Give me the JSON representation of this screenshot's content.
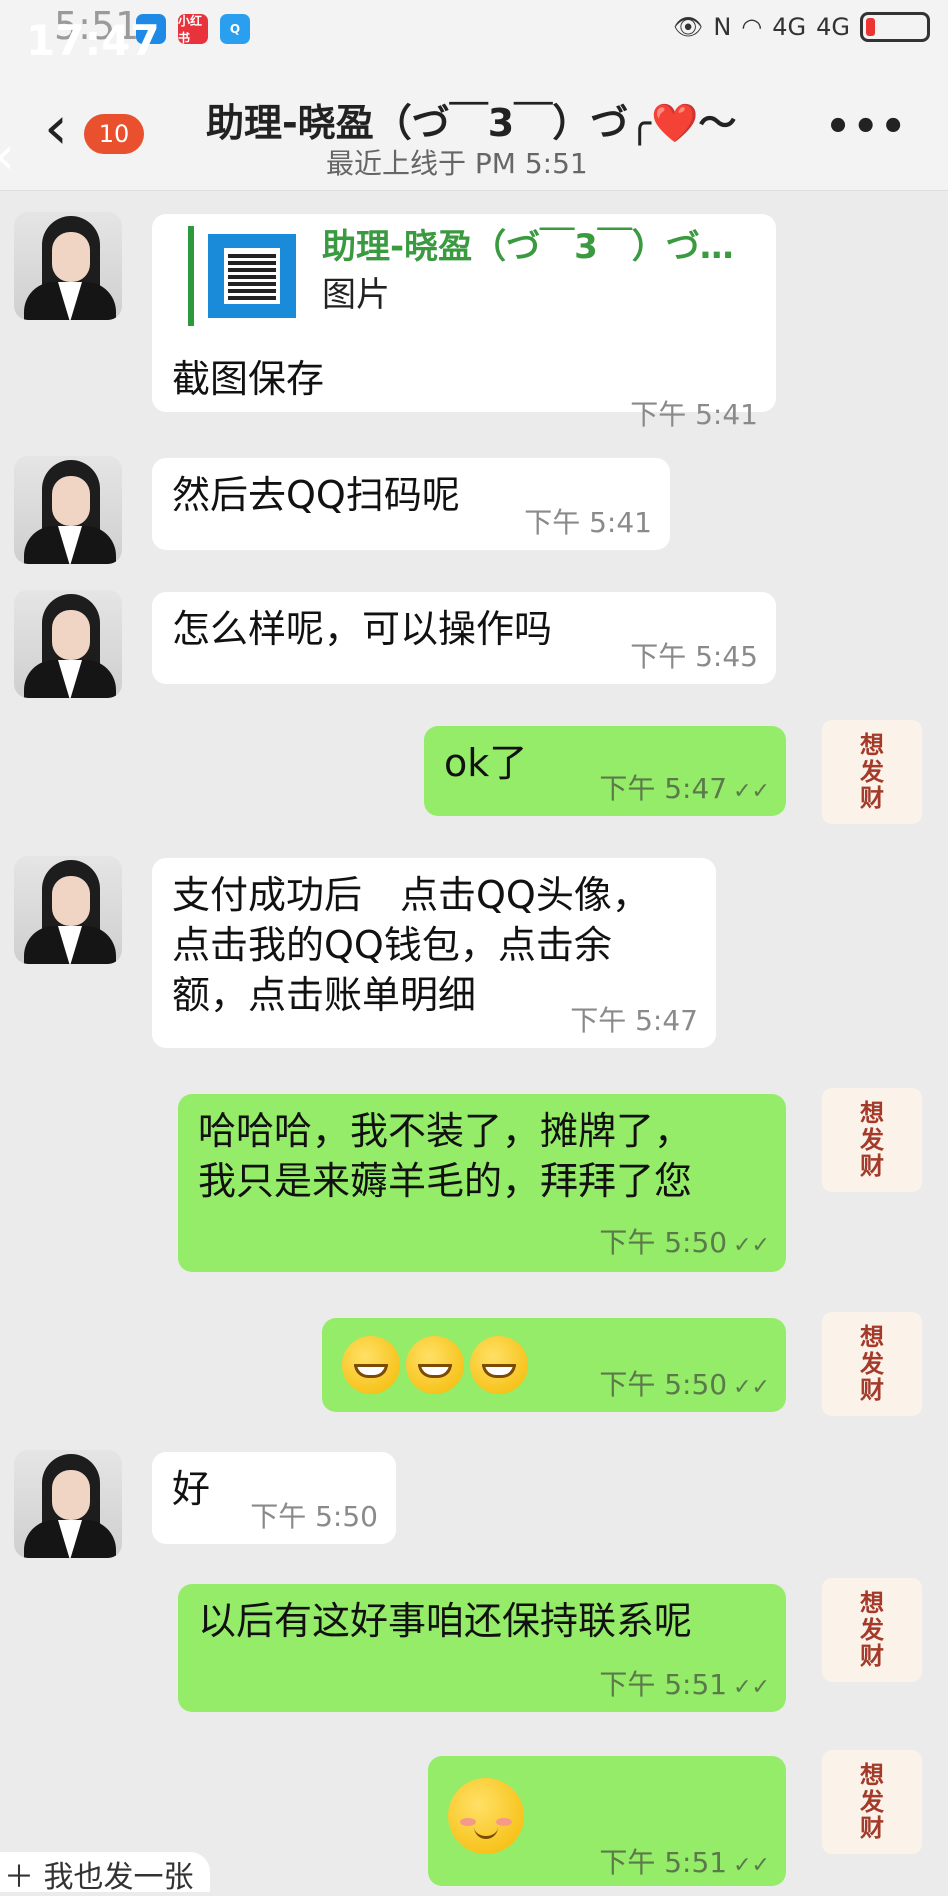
{
  "status_bar": {
    "time": "17:47",
    "time_ghost": "5:51",
    "app_icons": [
      "小红书",
      "Q"
    ],
    "signal_labels": [
      "N",
      "4G",
      "4G"
    ],
    "battery_level": 0.15
  },
  "header": {
    "unread_count": "10",
    "title": "助理-晓盈（づ￣3￣）づ╭❤️～",
    "subtitle": "最近上线于 PM 5:51",
    "more": "•••"
  },
  "messages": [
    {
      "side": "in",
      "type": "quote",
      "quote_name": "助理-晓盈（づ￣3￣）づ…",
      "quote_type": "图片",
      "text": "截图保存",
      "time": "下午 5:41"
    },
    {
      "side": "in",
      "text": "然后去QQ扫码呢",
      "time": "下午 5:41"
    },
    {
      "side": "in",
      "text": "怎么样呢，可以操作吗",
      "time": "下午 5:45"
    },
    {
      "side": "out",
      "text": "ok了",
      "time": "下午 5:47"
    },
    {
      "side": "in",
      "text_lines": [
        "支付成功后　点击QQ头像，",
        "点击我的QQ钱包，点击余",
        "额，点击账单明细"
      ],
      "time": "下午 5:47"
    },
    {
      "side": "out",
      "text_lines": [
        "哈哈哈，我不装了，摊牌了，",
        "我只是来薅羊毛的，拜拜了您"
      ],
      "time": "下午 5:50"
    },
    {
      "side": "out",
      "type": "emoji",
      "emoji": "grin-emoji x3",
      "time": "下午 5:50"
    },
    {
      "side": "in",
      "text": "好",
      "time": "下午 5:50"
    },
    {
      "side": "out",
      "text": "以后有这好事咱还保持联系呢",
      "time": "下午 5:51"
    },
    {
      "side": "out",
      "type": "emoji",
      "emoji": "shy-smile-emoji",
      "time": "下午 5:51"
    }
  ],
  "user_avatar": {
    "line1": "想",
    "line2": "发",
    "line3": "财"
  },
  "ticks": "✓✓",
  "bottom_chip": "＋ 我也发一张"
}
